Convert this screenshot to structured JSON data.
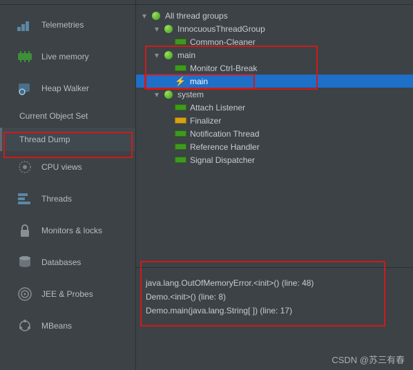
{
  "sidebar": {
    "items": [
      {
        "label": "Telemetries"
      },
      {
        "label": "Live memory"
      },
      {
        "label": "Heap Walker"
      },
      {
        "label": "Current Object Set"
      },
      {
        "label": "Thread Dump"
      },
      {
        "label": "CPU views"
      },
      {
        "label": "Threads"
      },
      {
        "label": "Monitors & locks"
      },
      {
        "label": "Databases"
      },
      {
        "label": "JEE & Probes"
      },
      {
        "label": "MBeans"
      }
    ]
  },
  "tree": {
    "root_label": "All thread groups",
    "nodes": [
      {
        "label": "InnocuousThreadGroup",
        "depth": 1,
        "icon": "group",
        "expanded": true
      },
      {
        "label": "Common-Cleaner",
        "depth": 2,
        "icon": "green-bar"
      },
      {
        "label": "main",
        "depth": 1,
        "icon": "group",
        "expanded": true
      },
      {
        "label": "Monitor Ctrl-Break",
        "depth": 2,
        "icon": "green-bar"
      },
      {
        "label": "main",
        "depth": 2,
        "icon": "lightning",
        "selected": true
      },
      {
        "label": "system",
        "depth": 1,
        "icon": "group",
        "expanded": true
      },
      {
        "label": "Attach Listener",
        "depth": 2,
        "icon": "green-bar"
      },
      {
        "label": "Finalizer",
        "depth": 2,
        "icon": "yellow-bar"
      },
      {
        "label": "Notification Thread",
        "depth": 2,
        "icon": "green-bar"
      },
      {
        "label": "Reference Handler",
        "depth": 2,
        "icon": "green-bar"
      },
      {
        "label": "Signal Dispatcher",
        "depth": 2,
        "icon": "green-bar"
      }
    ]
  },
  "stack": {
    "lines": [
      "java.lang.OutOfMemoryError.<init>() (line: 48)",
      "Demo.<init>() (line: 8)",
      "Demo.main(java.lang.String[ ]) (line: 17)"
    ]
  },
  "watermark": "CSDN @苏三有春"
}
